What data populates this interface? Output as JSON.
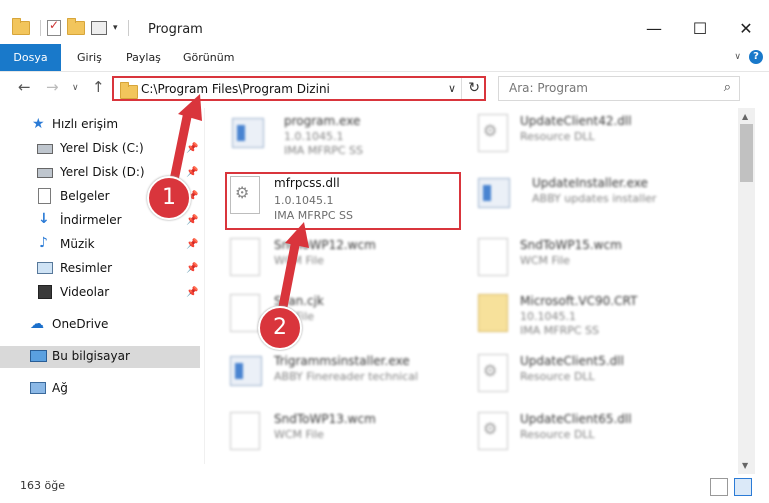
{
  "window": {
    "title": "Program"
  },
  "ribbon": {
    "tabs": [
      "Dosya",
      "Giriş",
      "Paylaş",
      "Görünüm"
    ]
  },
  "nav": {
    "address": "C:\\Program Files\\Program Dizini",
    "search_placeholder": "Ara: Program"
  },
  "sidebar": {
    "items": [
      {
        "label": "Hızlı erişim",
        "icon": "star-icon"
      },
      {
        "label": "Yerel Disk (C:)",
        "icon": "drive-icon"
      },
      {
        "label": "Yerel Disk (D:)",
        "icon": "drive-icon"
      },
      {
        "label": "Belgeler",
        "icon": "documents-icon"
      },
      {
        "label": "İndirmeler",
        "icon": "download-icon"
      },
      {
        "label": "Müzik",
        "icon": "music-icon"
      },
      {
        "label": "Resimler",
        "icon": "pictures-icon"
      },
      {
        "label": "Videolar",
        "icon": "video-icon"
      },
      {
        "label": "OneDrive",
        "icon": "cloud-icon"
      },
      {
        "label": "Bu bilgisayar",
        "icon": "computer-icon"
      },
      {
        "label": "Ağ",
        "icon": "network-icon"
      }
    ]
  },
  "files": {
    "left": [
      {
        "name": "program.exe",
        "line1": "1.0.1045.1",
        "line2": "IMA MFRPC SS"
      },
      {
        "name": "mfrpcss.dll",
        "line1": "1.0.1045.1",
        "line2": "IMA MFRPC SS"
      },
      {
        "name": "SndToWP12.wcm",
        "line1": "WCM File",
        "line2": ""
      },
      {
        "name": "Scan.cjk",
        "line1": "CJK File",
        "line2": ""
      },
      {
        "name": "Trigrammsinstaller.exe",
        "line1": "ABBY Finereader technical",
        "line2": ""
      },
      {
        "name": "SndToWP13.wcm",
        "line1": "WCM File",
        "line2": ""
      }
    ],
    "right": [
      {
        "name": "UpdateClient42.dll",
        "line1": "Resource DLL",
        "line2": ""
      },
      {
        "name": "UpdateInstaller.exe",
        "line1": "ABBY updates installer",
        "line2": ""
      },
      {
        "name": "SndToWP15.wcm",
        "line1": "WCM File",
        "line2": ""
      },
      {
        "name": "Microsoft.VC90.CRT",
        "line1": "10.1045.1",
        "line2": "IMA MFRPC SS"
      },
      {
        "name": "UpdateClient5.dll",
        "line1": "Resource DLL",
        "line2": ""
      },
      {
        "name": "UpdateClient65.dll",
        "line1": "Resource DLL",
        "line2": ""
      }
    ]
  },
  "status": {
    "count": "163 öğe"
  },
  "callouts": [
    "1",
    "2"
  ],
  "colors": {
    "accent": "#1979ca",
    "highlight": "#d9353c"
  }
}
